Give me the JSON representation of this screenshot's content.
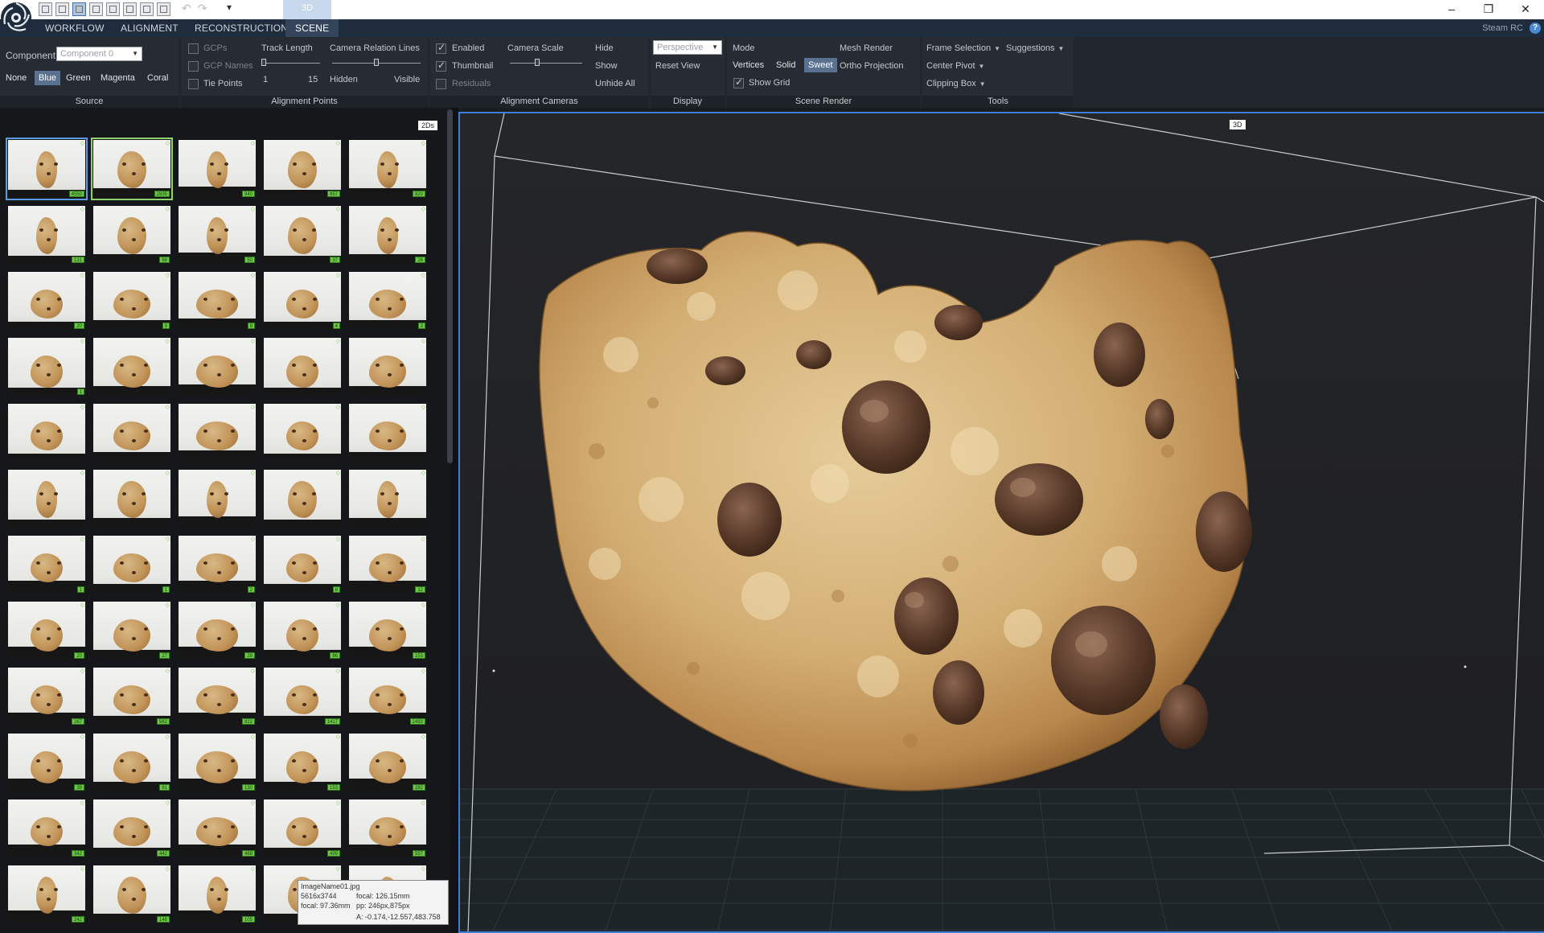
{
  "titlebar": {
    "tab_3d": "3D",
    "quick_access": "▾",
    "minimize": "–",
    "restore": "❐",
    "close": "✕"
  },
  "tabs": {
    "workflow": "WORKFLOW",
    "alignment": "ALIGNMENT",
    "reconstruction": "RECONSTRUCTION",
    "scene": "SCENE",
    "brand": "Steam RC",
    "help": "?"
  },
  "ribbon": {
    "source": {
      "title": "Source",
      "component_label": "Component",
      "component_value": "Component 0",
      "colors": [
        "None",
        "Blue",
        "Green",
        "Magenta",
        "Coral"
      ],
      "active_color": "Blue"
    },
    "alignment_points": {
      "title": "Alignment Points",
      "gcps": "GCPs",
      "gcp_names": "GCP Names",
      "tie_points": "Tie Points",
      "track_length": "Track Length",
      "track_min": "1",
      "track_max": "15",
      "camera_relation_lines": "Camera Relation Lines",
      "hidden": "Hidden",
      "visible": "Visible"
    },
    "alignment_cameras": {
      "title": "Alignment Cameras",
      "enabled": "Enabled",
      "thumbnail": "Thumbnail",
      "residuals": "Residuals",
      "camera_scale": "Camera Scale",
      "hide": "Hide",
      "show": "Show",
      "unhide_all": "Unhide All"
    },
    "display": {
      "title": "Display",
      "projection_value": "Perspective",
      "reset_view": "Reset View"
    },
    "scene_render": {
      "title": "Scene Render",
      "mode": "Mode",
      "vertices": "Vertices",
      "solid": "Solid",
      "sweet": "Sweet",
      "active_mode": "Sweet",
      "mesh_render": "Mesh Render",
      "ortho_projection": "Ortho Projection",
      "show_grid": "Show Grid"
    },
    "tools": {
      "title": "Tools",
      "frame_selection": "Frame Selection",
      "suggestions": "Suggestions",
      "center_pivot": "Center Pivot",
      "clipping_box": "Clipping Box"
    }
  },
  "panel_2d": {
    "label": "2Ds",
    "badges": [
      "4550",
      "2835",
      "940",
      "857",
      "820",
      "131",
      "68",
      "50",
      "37",
      "26",
      "20",
      "9",
      "8",
      "4",
      "3",
      "1",
      "",
      "",
      "",
      "",
      "",
      "",
      "",
      "",
      "",
      "",
      "",
      "",
      "",
      "",
      "1",
      "1",
      "2",
      "8",
      "12",
      "20",
      "27",
      "28",
      "86",
      "153",
      "267",
      "562",
      "822",
      "1417",
      "2493",
      "39",
      "61",
      "130",
      "153",
      "282",
      "342",
      "442",
      "488",
      "499",
      "557",
      "242",
      "146",
      "105",
      "",
      ""
    ],
    "tooltip": {
      "name": "ImageName01.jpg",
      "resolution": "5616x3744",
      "focal_equiv": "focal: 97.36mm",
      "focal": "focal: 126.15mm",
      "pp": "pp: 246px,875px",
      "coords": "A: -0.174,-12.557,483.758"
    }
  },
  "viewport": {
    "label": "3D"
  }
}
